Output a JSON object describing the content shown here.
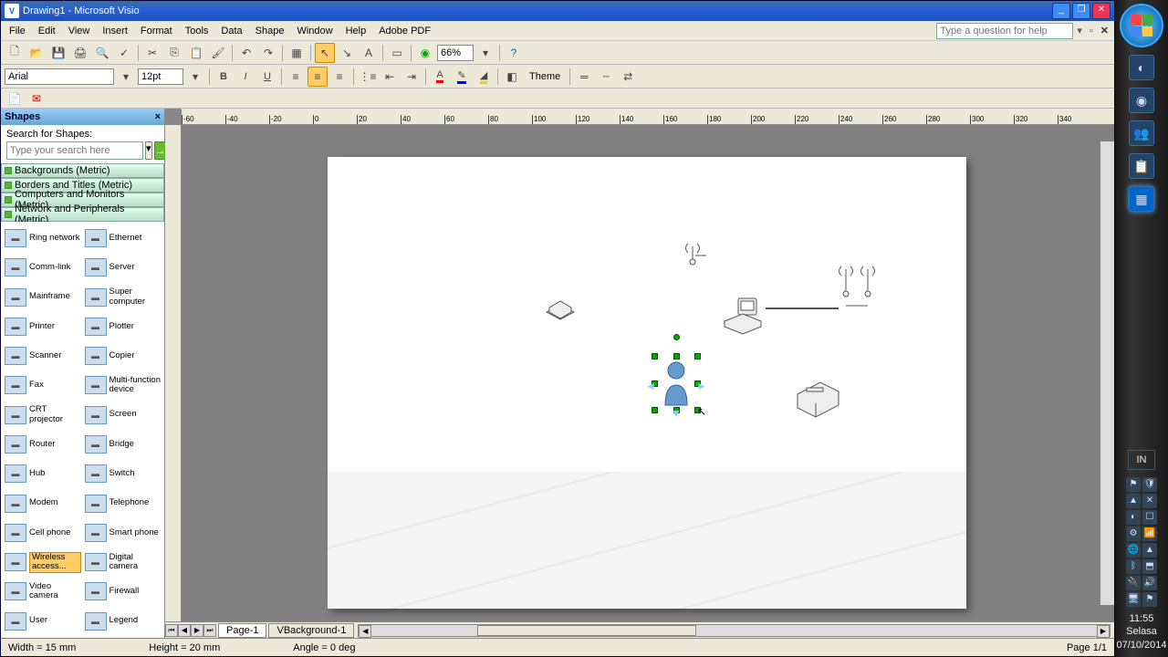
{
  "title": "Drawing1 - Microsoft Visio",
  "menus": [
    "File",
    "Edit",
    "View",
    "Insert",
    "Format",
    "Tools",
    "Data",
    "Shape",
    "Window",
    "Help",
    "Adobe PDF"
  ],
  "help_placeholder": "Type a question for help",
  "zoom": "66%",
  "font": "Arial",
  "fontsize": "12pt",
  "theme_label": "Theme",
  "shapes": {
    "title": "Shapes",
    "search_label": "Search for Shapes:",
    "search_placeholder": "Type your search here",
    "stencils": [
      "Backgrounds (Metric)",
      "Borders and Titles (Metric)",
      "Computers and Monitors (Metric)",
      "Network and Peripherals (Metric)"
    ],
    "items": [
      {
        "l": "Ring network"
      },
      {
        "l": "Ethernet"
      },
      {
        "l": "Comm-link"
      },
      {
        "l": "Server"
      },
      {
        "l": "Mainframe"
      },
      {
        "l": "Super computer"
      },
      {
        "l": "Printer"
      },
      {
        "l": "Plotter"
      },
      {
        "l": "Scanner"
      },
      {
        "l": "Copier"
      },
      {
        "l": "Fax"
      },
      {
        "l": "Multi-function device"
      },
      {
        "l": "CRT projector"
      },
      {
        "l": "Screen"
      },
      {
        "l": "Router"
      },
      {
        "l": "Bridge"
      },
      {
        "l": "Hub"
      },
      {
        "l": "Switch"
      },
      {
        "l": "Modem"
      },
      {
        "l": "Telephone"
      },
      {
        "l": "Cell phone"
      },
      {
        "l": "Smart phone"
      },
      {
        "l": "Wireless access...",
        "sel": true
      },
      {
        "l": "Digital camera"
      },
      {
        "l": "Video camera"
      },
      {
        "l": "Firewall"
      },
      {
        "l": "User"
      },
      {
        "l": "Legend"
      }
    ]
  },
  "ruler_h": [
    "-60",
    "-40",
    "-20",
    "0",
    "20",
    "40",
    "60",
    "80",
    "100",
    "120",
    "140",
    "160",
    "180",
    "200",
    "220",
    "240",
    "260",
    "280",
    "300",
    "320",
    "340"
  ],
  "tabs": {
    "page": "Page-1",
    "bg": "VBackground-1"
  },
  "status": {
    "w": "Width = 15 mm",
    "h": "Height = 20 mm",
    "a": "Angle = 0 deg",
    "p": "Page 1/1"
  },
  "taskbar": {
    "lang": "IN",
    "time": "11:55",
    "day": "Selasa",
    "date": "07/10/2014"
  }
}
